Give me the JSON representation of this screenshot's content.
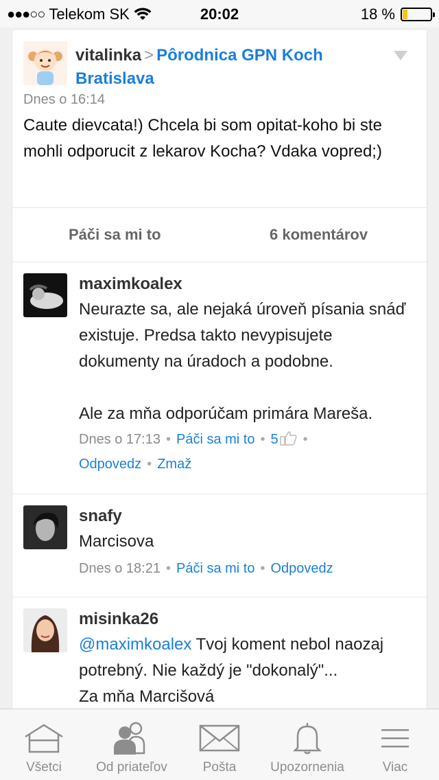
{
  "status_bar": {
    "signal": "●●●○○",
    "carrier": "Telekom SK",
    "time": "20:02",
    "battery_percent": "18 %",
    "battery_level": 0.18
  },
  "post": {
    "author": "vitalinka",
    "separator": ">",
    "group": "Pôrodnica GPN Koch Bratislava",
    "time": "Dnes o 16:14",
    "body": "Caute dievcata!) Chcela bi som opitat-koho bi ste mohli odporucit z lekarov Kocha? Vdaka vopred;)",
    "like_label": "Páči sa mi to",
    "comments_label": "6 komentárov"
  },
  "comments": [
    {
      "name": "maximkoalex",
      "text": "Neurazte sa, ale nejaká úroveň písania snáď existuje. Predsa takto nevypisujete dokumenty na úradoch a podobne.",
      "text2": "Ale za mňa odporúčam primára Mareša.",
      "time": "Dnes o 17:13",
      "like": "Páči sa mi to",
      "like_count": "5",
      "reply": "Odpovedz",
      "delete": "Zmaž"
    },
    {
      "name": "snafy",
      "text": "Marcisova",
      "time": "Dnes o 18:21",
      "like": "Páči sa mi to",
      "reply": "Odpovedz"
    },
    {
      "name": "misinka26",
      "mention": "@maximkoalex",
      "text": " Tvoj koment nebol naozaj potrebný. Nie každý je \"dokonalý\"...",
      "text2": "Za mňa Marcišová"
    }
  ],
  "tabs": [
    {
      "label": "Všetci",
      "icon": "house-icon"
    },
    {
      "label": "Od priateľov",
      "icon": "friends-icon"
    },
    {
      "label": "Pošta",
      "icon": "mail-icon"
    },
    {
      "label": "Upozornenia",
      "icon": "bell-icon"
    },
    {
      "label": "Viac",
      "icon": "menu-icon"
    }
  ],
  "colors": {
    "link": "#1a7fd9",
    "muted": "#8a8a8a",
    "battery": "#f5c518"
  }
}
